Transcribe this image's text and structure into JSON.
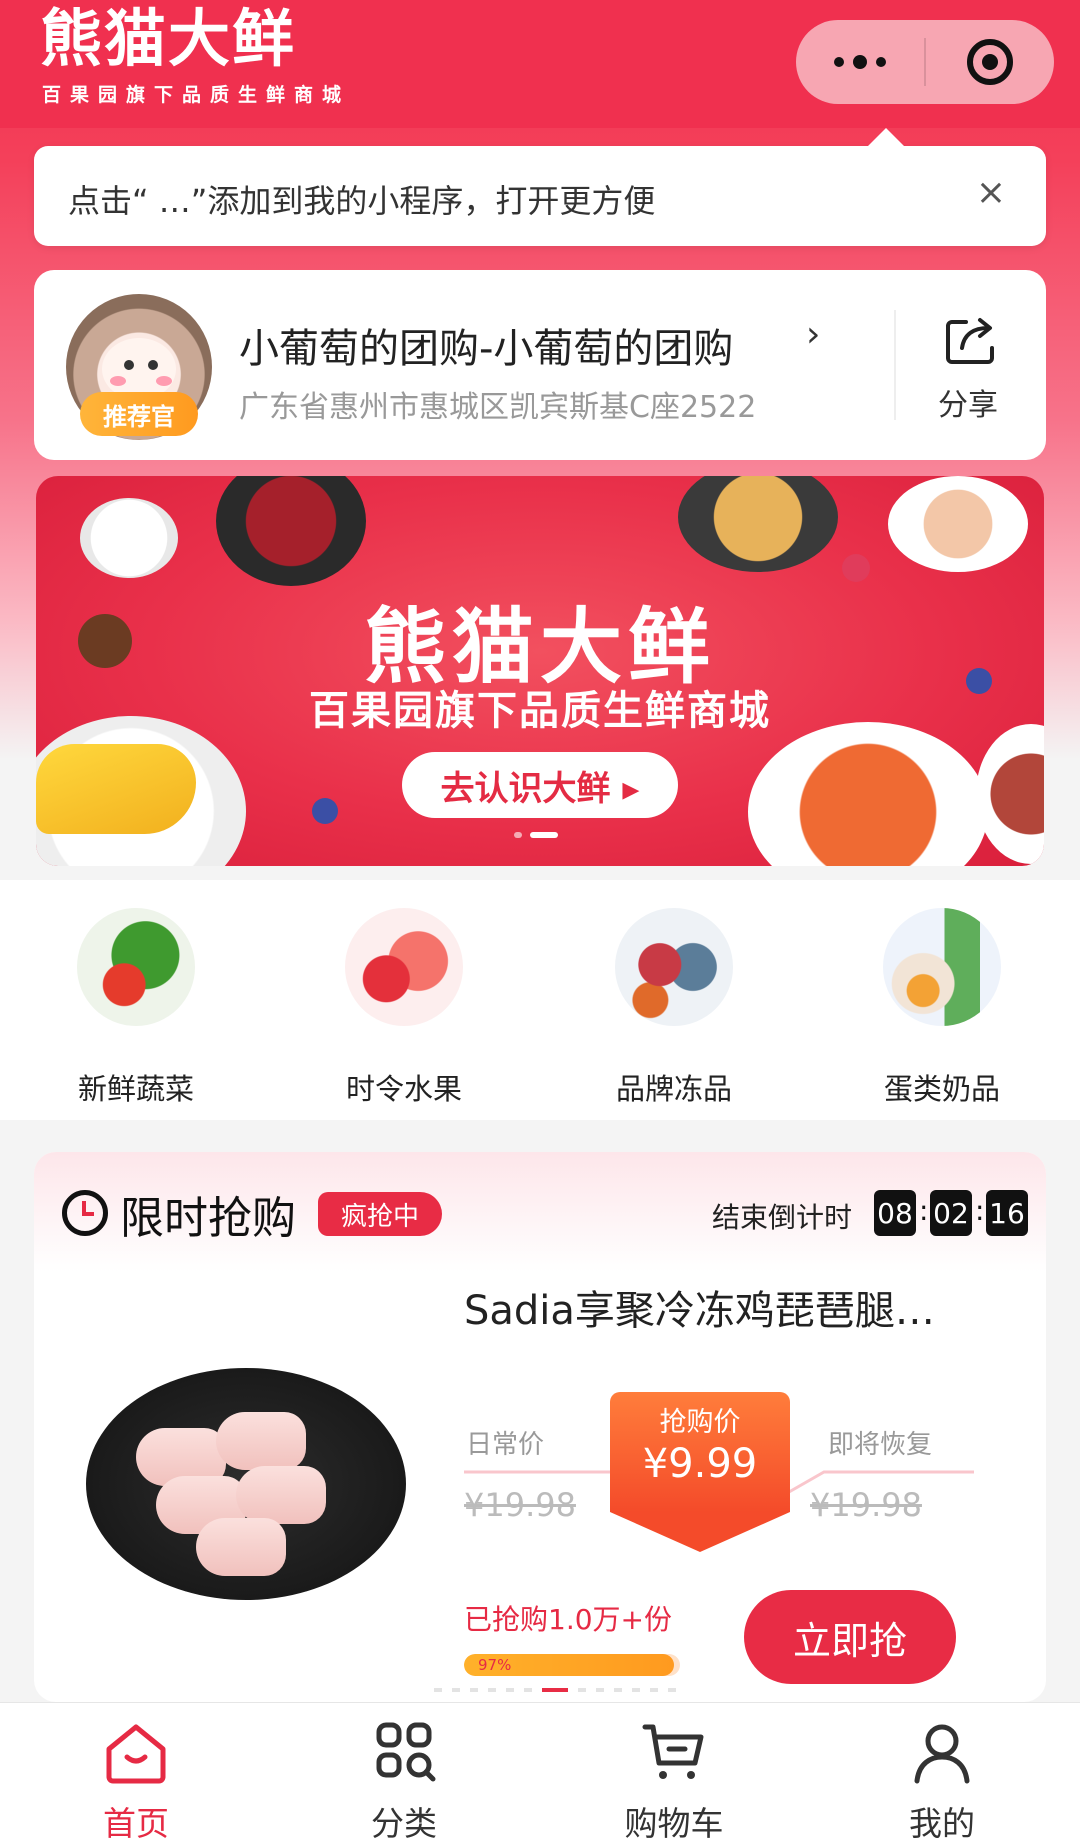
{
  "header": {
    "logo_title": "熊猫大鲜",
    "logo_subtitle": "百果园旗下品质生鲜商城"
  },
  "tip": {
    "text": "点击“ …”添加到我的小程序，打开更方便",
    "close": "×"
  },
  "leader": {
    "name": "小葡萄的团购-小葡萄的团购",
    "chevron": "›",
    "address": "广东省惠州市惠城区凯宾斯基C座2522",
    "badge": "推荐官",
    "share_label": "分享"
  },
  "banner": {
    "title": "熊猫大鲜",
    "subtitle": "百果园旗下品质生鲜商城",
    "button": "去认识大鲜 ▸"
  },
  "categories": [
    {
      "label": "新鲜蔬菜"
    },
    {
      "label": "时令水果"
    },
    {
      "label": "品牌冻品"
    },
    {
      "label": "蛋类奶品"
    }
  ],
  "flash_sale": {
    "title": "限时抢购",
    "tag": "疯抢中",
    "countdown_label": "结束倒计时",
    "countdown": [
      "08",
      "02",
      "16"
    ],
    "product": {
      "name": "Sadia享聚冷冻鸡琵琶腿…",
      "regular_label": "日常价",
      "regular_price": "¥19.98",
      "grab_label": "抢购价",
      "grab_price": "¥9.99",
      "restore_label": "即将恢复",
      "restore_price": "¥19.98",
      "sold": "已抢购1.0万+份",
      "progress": 0.97,
      "progress_text": "97%",
      "buy_button": "立即抢"
    }
  },
  "tabbar": [
    {
      "label": "首页",
      "icon": "home-icon",
      "active": true
    },
    {
      "label": "分类",
      "icon": "category-icon",
      "active": false
    },
    {
      "label": "购物车",
      "icon": "cart-icon",
      "active": false
    },
    {
      "label": "我的",
      "icon": "user-icon",
      "active": false
    }
  ],
  "colors": {
    "brand_red": "#f0304f",
    "accent_red": "#e82c45",
    "orange": "#ff9a1f"
  }
}
